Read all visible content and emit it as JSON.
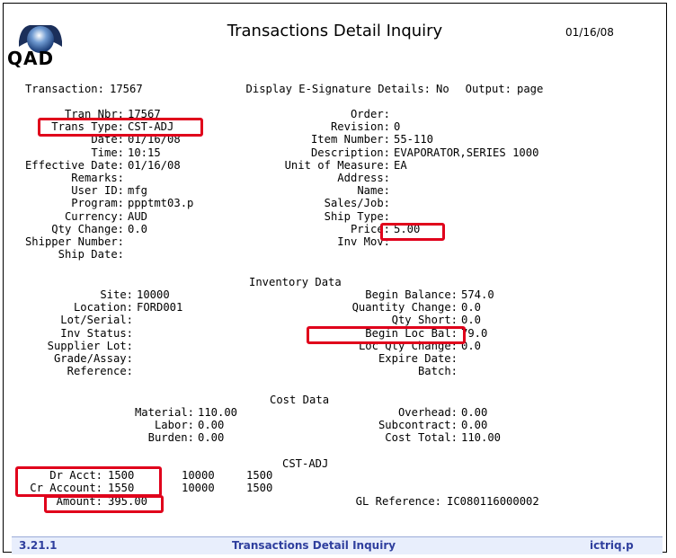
{
  "header": {
    "title": "Transactions Detail Inquiry",
    "date": "01/16/08",
    "logo_text": "QAD"
  },
  "top_line": {
    "transaction_label": "Transaction:",
    "transaction_value": "17567",
    "esig_label": "Display E-Signature Details:",
    "esig_value": "No",
    "output_label": "Output:",
    "output_value": "page"
  },
  "left_fields": [
    {
      "label": "Tran Nbr:",
      "value": "17567"
    },
    {
      "label": "Trans Type:",
      "value": "CST-ADJ"
    },
    {
      "label": "Date:",
      "value": "01/16/08"
    },
    {
      "label": "Time:",
      "value": "10:15"
    },
    {
      "label": "Effective Date:",
      "value": "01/16/08"
    },
    {
      "label": "Remarks:",
      "value": ""
    },
    {
      "label": "User ID:",
      "value": "mfg"
    },
    {
      "label": "Program:",
      "value": "ppptmt03.p"
    },
    {
      "label": "Currency:",
      "value": "AUD"
    },
    {
      "label": "Qty Change:",
      "value": "0.0"
    },
    {
      "label": "Shipper Number:",
      "value": ""
    },
    {
      "label": "Ship Date:",
      "value": ""
    }
  ],
  "right_fields": [
    {
      "label": "Order:",
      "value": ""
    },
    {
      "label": "Revision:",
      "value": "0"
    },
    {
      "label": "Item Number:",
      "value": "55-110"
    },
    {
      "label": "Description:",
      "value": "EVAPORATOR,SERIES 1000"
    },
    {
      "label": "Unit of Measure:",
      "value": "EA"
    },
    {
      "label": "Address:",
      "value": ""
    },
    {
      "label": "Name:",
      "value": ""
    },
    {
      "label": "Sales/Job:",
      "value": ""
    },
    {
      "label": "Ship Type:",
      "value": ""
    },
    {
      "label": "Price:",
      "value": "5.00"
    },
    {
      "label": "Inv Mov:",
      "value": ""
    }
  ],
  "inventory": {
    "heading": "Inventory Data",
    "left": [
      {
        "label": "Site:",
        "value": "10000"
      },
      {
        "label": "Location:",
        "value": "FORD001"
      },
      {
        "label": "Lot/Serial:",
        "value": ""
      },
      {
        "label": "Inv Status:",
        "value": ""
      },
      {
        "label": "Supplier Lot:",
        "value": ""
      },
      {
        "label": "Grade/Assay:",
        "value": ""
      },
      {
        "label": "Reference:",
        "value": ""
      }
    ],
    "right": [
      {
        "label": "Begin Balance:",
        "value": "574.0"
      },
      {
        "label": "Quantity Change:",
        "value": "0.0"
      },
      {
        "label": "Qty Short:",
        "value": "0.0"
      },
      {
        "label": "Begin Loc Bal:",
        "value": "79.0"
      },
      {
        "label": "Loc Qty Change:",
        "value": "0.0"
      },
      {
        "label": "Expire Date:",
        "value": ""
      },
      {
        "label": "Batch:",
        "value": ""
      }
    ]
  },
  "cost": {
    "heading": "Cost Data",
    "left": [
      {
        "label": "Material:",
        "value": "110.00"
      },
      {
        "label": "Labor:",
        "value": "0.00"
      },
      {
        "label": "Burden:",
        "value": "0.00"
      }
    ],
    "right": [
      {
        "label": "Overhead:",
        "value": "0.00"
      },
      {
        "label": "Subcontract:",
        "value": "0.00"
      },
      {
        "label": "Cost Total:",
        "value": "110.00"
      }
    ]
  },
  "gl": {
    "heading": "CST-ADJ",
    "dr_label": "Dr Acct:",
    "dr_acct": "1500",
    "dr_sub": "10000",
    "dr_cc": "1500",
    "cr_label": "Cr Account:",
    "cr_acct": "1550",
    "cr_sub": "10000",
    "cr_cc": "1500",
    "amount_label": "Amount:",
    "amount_value": "395.00",
    "glref_label": "GL Reference:",
    "glref_value": "IC080116000002"
  },
  "footer": {
    "version": "3.21.1",
    "title": "Transactions Detail Inquiry",
    "program": "ictriq.p"
  },
  "colors": {
    "highlight": "#e0001b",
    "footer_text": "#2f3f9e",
    "footer_bg": "#e8eefc"
  }
}
